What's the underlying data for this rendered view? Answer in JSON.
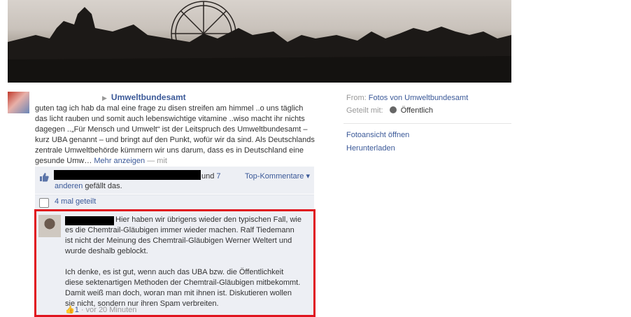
{
  "post": {
    "author": "Umweltbundesamt",
    "text": "guten tag ich hab da mal eine frage zu disen streifen am himmel ..o uns täglich das licht rauben und somit auch lebenswichtige vitamine ..wiso macht ihr nichts dagegen ..„Für Mensch und Umwelt“ ist der Leitspruch des Umweltbundesamt – kurz UBA genannt – und bringt auf den Punkt, wofür wir da sind. Als Deutschlands zentrale Umweltbehörde kümmern wir uns darum, dass es in Deutschland eine gesunde Umw…",
    "more_link": "Mehr anzeigen",
    "more_suffix": " — mit"
  },
  "likes": {
    "und": "und",
    "others_link": "7 anderen",
    "suffix": " gefällt das.",
    "top_comments": "Top-Kommentare ▾"
  },
  "shares": {
    "label": "4 mal geteilt"
  },
  "comment": {
    "para1": "Hier haben wir übrigens wieder den typischen Fall, wie es die Chemtrail-Gläubigen immer wieder machen. Ralf Tiedemann ist nicht der Meinung des Chemtrail-Gläubigen Werner Weltert und wurde deshalb geblockt.",
    "para2": "Ich denke, es ist gut, wenn auch das UBA bzw. die Öffentlichkeit diese sektenartigen Methoden der Chemtrail-Gläubigen mitbekommt. Damit weiß man doch, woran man mit ihnen ist. Diskutieren wollen sie nicht, sondern nur ihren Spam verbreiten.",
    "like_count": "1",
    "time": " · vor 20 Minuten",
    "highlight_color": "#e0141e"
  },
  "sidebar": {
    "from_label": "From:",
    "from_link": "Fotos von Umweltbundesamt",
    "shared_label": "Geteilt mit:",
    "shared_value": "Öffentlich",
    "open_photo": "Fotoansicht öffnen",
    "download": "Herunterladen"
  }
}
